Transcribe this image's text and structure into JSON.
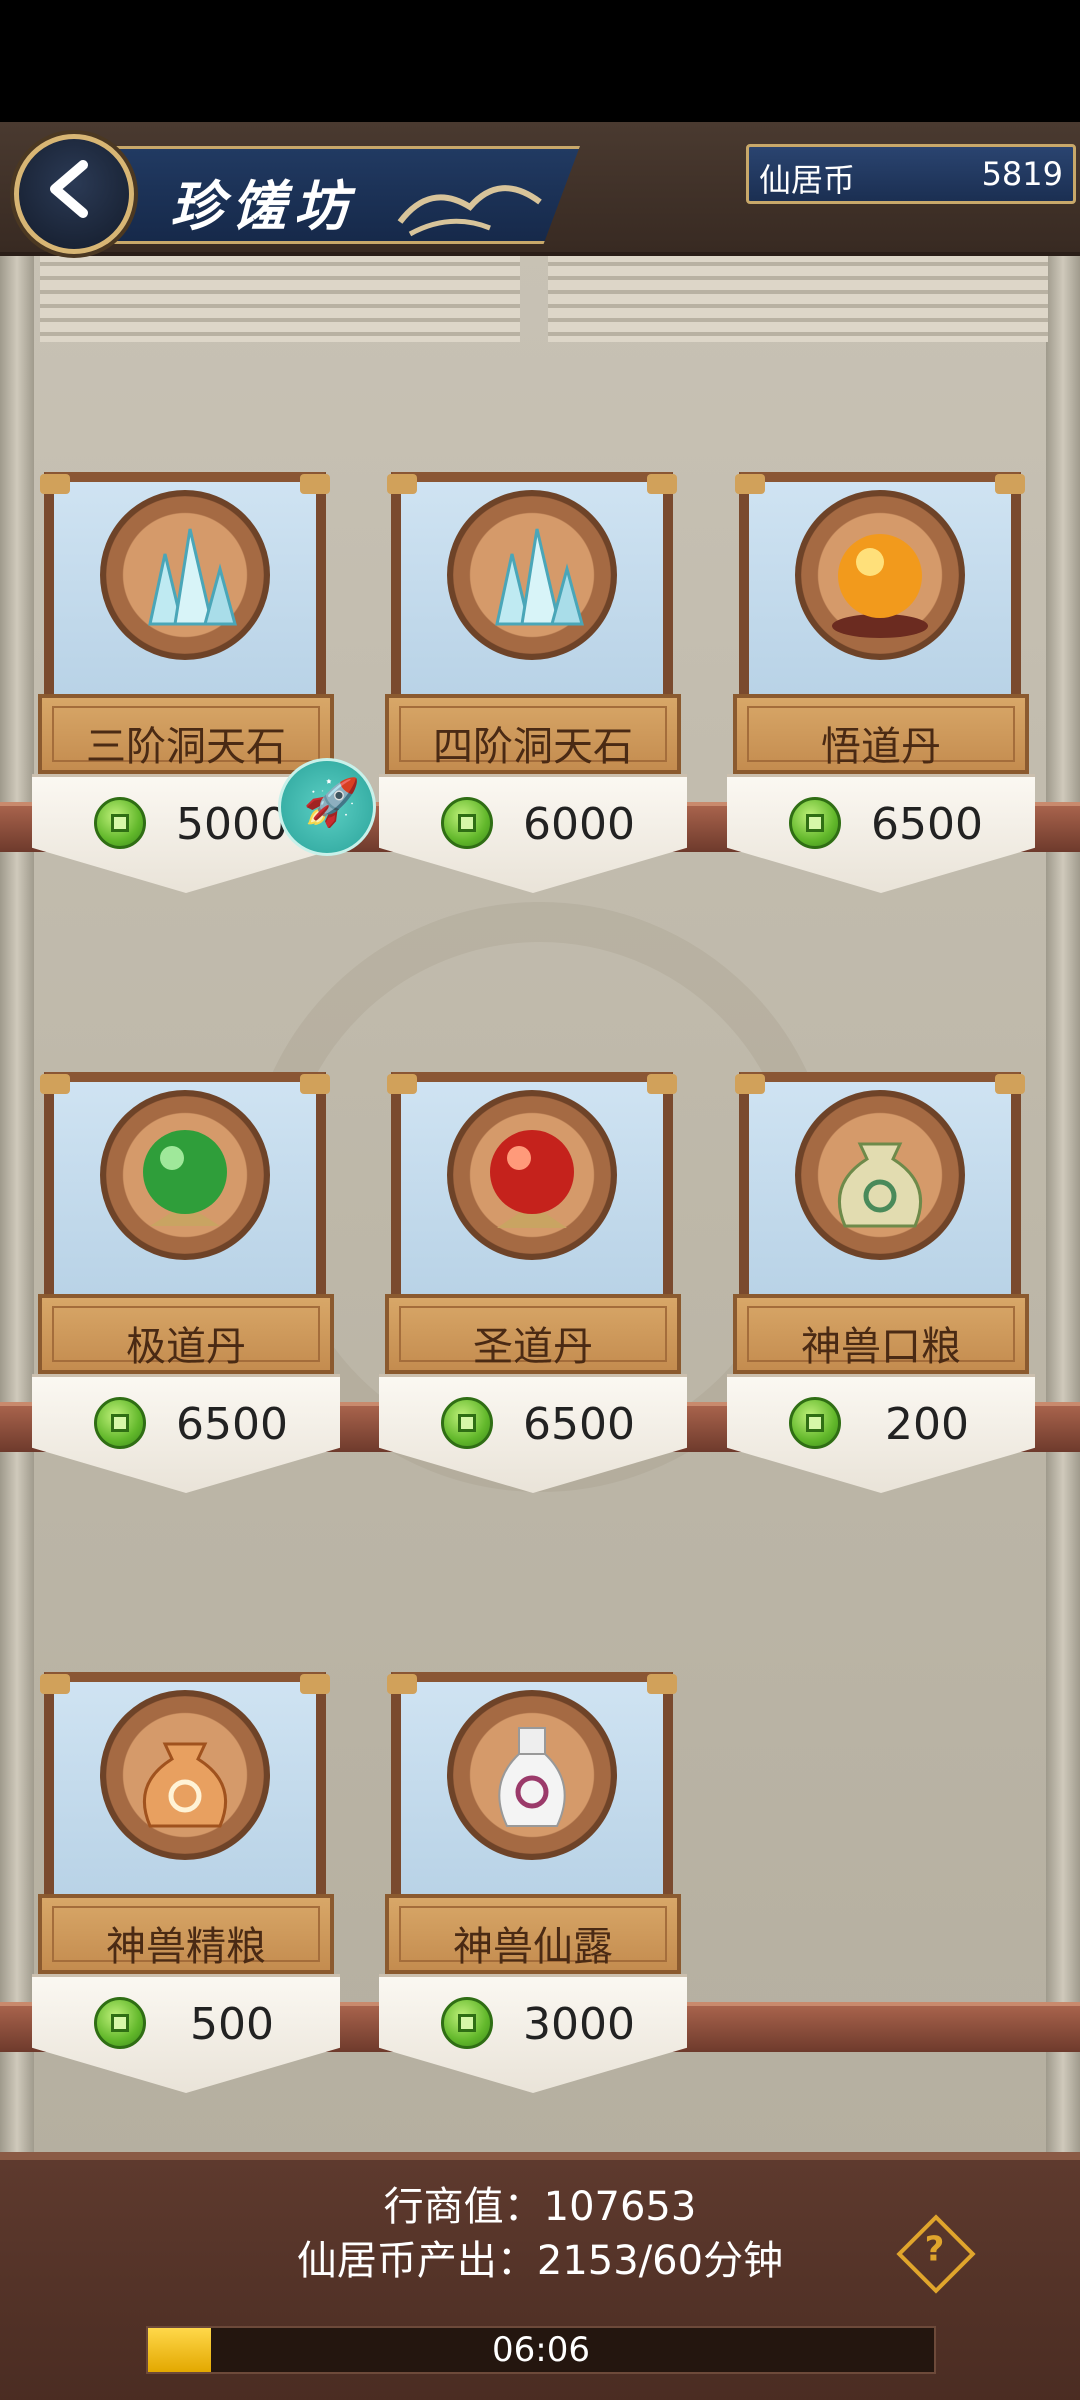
{
  "header": {
    "title": "珍馐坊",
    "currency_label": "仙居币",
    "currency_value": "5819"
  },
  "items": [
    {
      "name": "三阶洞天石",
      "price": "5000",
      "icon": "crystal-icon"
    },
    {
      "name": "四阶洞天石",
      "price": "6000",
      "icon": "crystal-icon"
    },
    {
      "name": "悟道丹",
      "price": "6500",
      "icon": "orange-orb-icon"
    },
    {
      "name": "极道丹",
      "price": "6500",
      "icon": "green-orb-icon"
    },
    {
      "name": "圣道丹",
      "price": "6500",
      "icon": "red-orb-icon"
    },
    {
      "name": "神兽口粮",
      "price": "200",
      "icon": "green-sack-icon"
    },
    {
      "name": "神兽精粮",
      "price": "500",
      "icon": "orange-sack-icon"
    },
    {
      "name": "神兽仙露",
      "price": "3000",
      "icon": "vase-icon"
    }
  ],
  "footer": {
    "merchant_value": "行商值：107653",
    "coin_output": "仙居币产出：2153/60分钟",
    "timer": "06:06",
    "progress_fraction": 0.08
  },
  "colors": {
    "accent": "#c8a86a",
    "coin": "#62b82b",
    "progress": "#ffd84a"
  }
}
